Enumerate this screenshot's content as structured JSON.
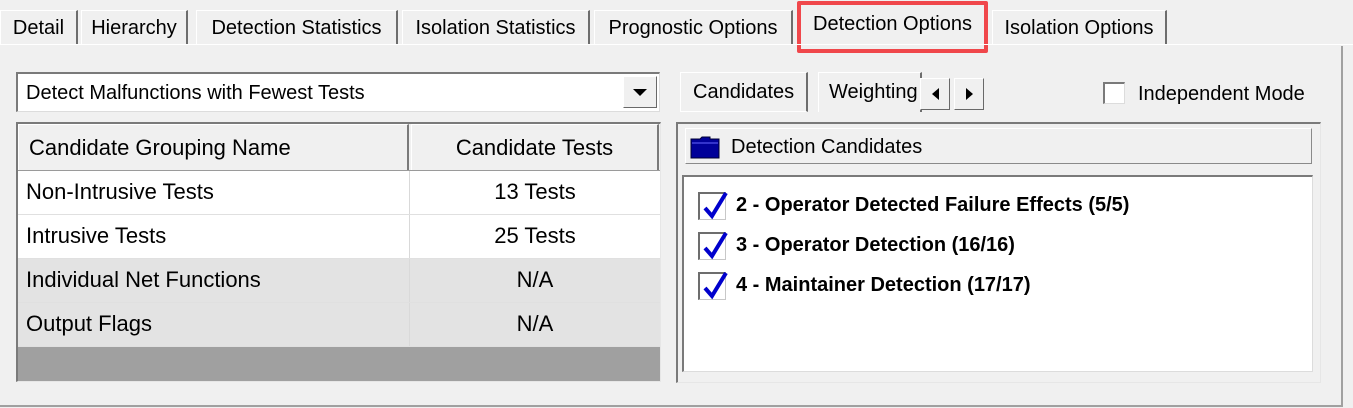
{
  "tabs": [
    {
      "label": "Detail"
    },
    {
      "label": "Hierarchy"
    },
    {
      "label": "Detection Statistics"
    },
    {
      "label": "Isolation Statistics"
    },
    {
      "label": "Prognostic Options"
    },
    {
      "label": "Detection Options"
    },
    {
      "label": "Isolation Options"
    }
  ],
  "active_tab": "Detection Options",
  "strategy_dropdown": {
    "value": "Detect Malfunctions with Fewest Tests"
  },
  "grouping_table": {
    "headers": {
      "name": "Candidate Grouping Name",
      "tests": "Candidate Tests"
    },
    "rows": [
      {
        "name": "Non-Intrusive Tests",
        "tests": "13 Tests"
      },
      {
        "name": "Intrusive Tests",
        "tests": "25 Tests"
      },
      {
        "name": "Individual Net Functions",
        "tests": "N/A"
      },
      {
        "name": "Output Flags",
        "tests": "N/A"
      }
    ]
  },
  "sub_tabs": [
    {
      "label": "Candidates"
    },
    {
      "label": "Weighting"
    }
  ],
  "independent_mode": {
    "label": "Independent Mode",
    "checked": false
  },
  "detection_candidates": {
    "header": "Detection Candidates",
    "items": [
      {
        "label": "2 - Operator Detected Failure Effects (5/5)",
        "checked": true
      },
      {
        "label": "3 - Operator Detection (16/16)",
        "checked": true
      },
      {
        "label": "4 - Maintainer Detection (17/17)",
        "checked": true
      }
    ]
  },
  "colors": {
    "highlight": "#f0474b",
    "check": "#0000cc",
    "folder": "#000099"
  }
}
